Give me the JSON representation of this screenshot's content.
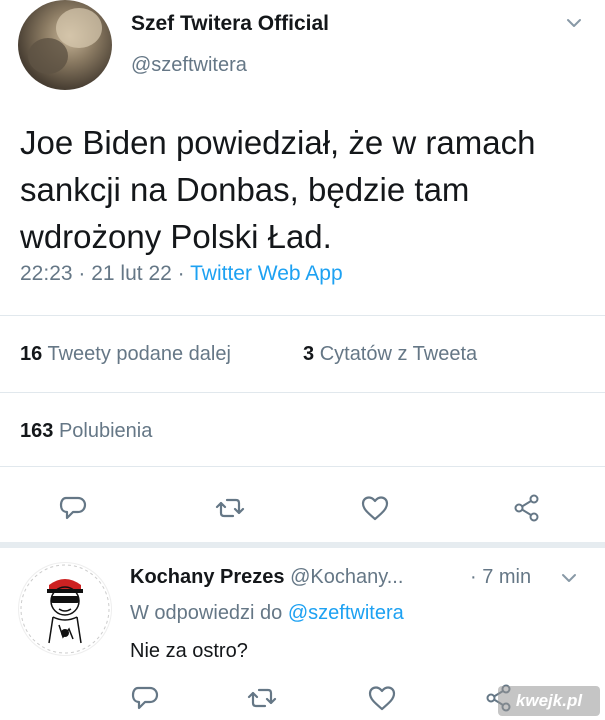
{
  "tweet": {
    "display_name": "Szef Twitera Official",
    "handle": "@szeftwitera",
    "text": "Joe Biden powiedział, że w ramach sankcji na Donbas, będzie tam wdrożony Polski Ład.",
    "time": "22:23",
    "date": "21 lut 22",
    "source": "Twitter Web App",
    "separator": " · "
  },
  "stats": {
    "retweets_count": "16",
    "retweets_label": "Tweety podane dalej",
    "quotes_count": "3",
    "quotes_label": "Cytatów z Tweeta",
    "likes_count": "163",
    "likes_label": "Polubienia"
  },
  "icons": {
    "reply": "reply-icon",
    "retweet": "retweet-icon",
    "like": "heart-icon",
    "share": "share-icon",
    "menu": "chevron-down-icon"
  },
  "reply": {
    "display_name": "Kochany Prezes",
    "handle": "@Kochany...",
    "time": "· 7 min",
    "replying_to_label": "W odpowiedzi do",
    "replying_to_handle": "@szeftwitera",
    "text": "Nie za ostro?"
  },
  "watermark": "kwejk.pl",
  "colors": {
    "accent": "#1da1f2",
    "secondary_text": "#657786",
    "primary_text": "#14171a"
  }
}
